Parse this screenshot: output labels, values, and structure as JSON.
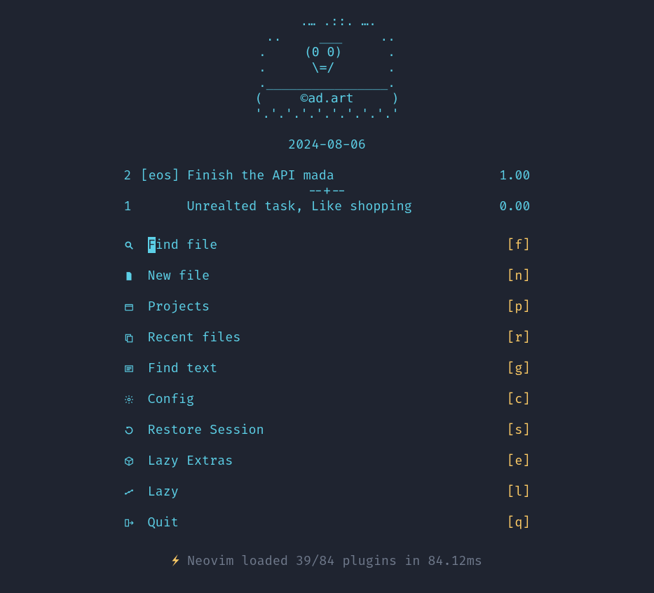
{
  "ascii_art": "   .… .::. ….\n ..     ___     ..\n.     (0 0)      .\n.      \\=/       .\n.________________.\n(     ©ad.art     )\n'.'.'.'.'.'.'.'.'.'",
  "date": "2024-08-06",
  "tasks": [
    {
      "num": "2",
      "tag": "[eos]",
      "desc": "Finish the API mada",
      "score": "1.00"
    },
    {
      "num": "1",
      "tag": "",
      "desc": "Unrealted task, Like shopping",
      "score": "0.00"
    }
  ],
  "divider": "--+--",
  "menu": [
    {
      "icon": "search",
      "label_first": "F",
      "label_rest": "ind file",
      "key": "[f]"
    },
    {
      "icon": "file",
      "label_first": "",
      "label_rest": "New file",
      "key": "[n]"
    },
    {
      "icon": "project",
      "label_first": "",
      "label_rest": "Projects",
      "key": "[p]"
    },
    {
      "icon": "recent",
      "label_first": "",
      "label_rest": "Recent files",
      "key": "[r]"
    },
    {
      "icon": "grep",
      "label_first": "",
      "label_rest": "Find text",
      "key": "[g]"
    },
    {
      "icon": "gear",
      "label_first": "",
      "label_rest": "Config",
      "key": "[c]"
    },
    {
      "icon": "restore",
      "label_first": "",
      "label_rest": "Restore Session",
      "key": "[s]"
    },
    {
      "icon": "package",
      "label_first": "",
      "label_rest": "Lazy Extras",
      "key": "[e]"
    },
    {
      "icon": "lazy",
      "label_first": "",
      "label_rest": "Lazy",
      "key": "[l]"
    },
    {
      "icon": "quit",
      "label_first": "",
      "label_rest": "Quit",
      "key": "[q]"
    }
  ],
  "footer": {
    "bolt": "⚡",
    "text": "Neovim loaded 39/84 plugins in 84.12ms"
  }
}
